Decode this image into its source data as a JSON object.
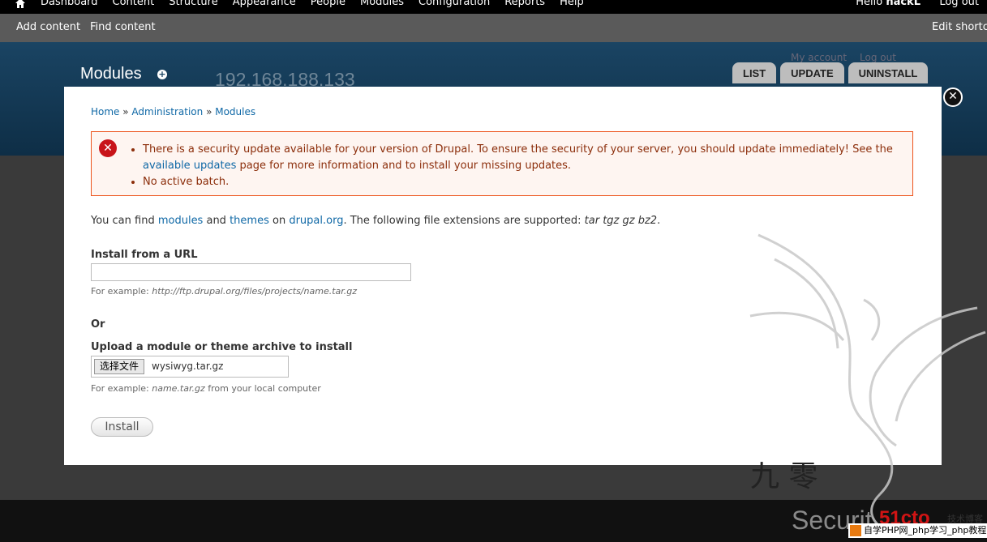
{
  "toolbar": {
    "menu": [
      "Dashboard",
      "Content",
      "Structure",
      "Appearance",
      "People",
      "Modules",
      "Configuration",
      "Reports",
      "Help"
    ],
    "hello": "Hello ",
    "username": "hackL",
    "logout": "Log out"
  },
  "shortcuts": {
    "add_content": "Add content",
    "find_content": "Find content",
    "edit_shortcuts": "Edit shortcuts"
  },
  "header": {
    "title": "Modules",
    "site_ip": "192.168.188.133",
    "my_account": "My account",
    "log_out": "Log out",
    "tabs": [
      "LIST",
      "UPDATE",
      "UNINSTALL"
    ]
  },
  "breadcrumb": [
    "Home",
    "Administration",
    "Modules"
  ],
  "messages": {
    "security_pre": "There is a security update available for your version of Drupal. To ensure the security of your server, you should update immediately! See the ",
    "security_link": "available updates",
    "security_post": " page for more information and to install your missing updates.",
    "batch": "No active batch."
  },
  "intro": {
    "t1": "You can find ",
    "modules_link": "modules",
    "t2": " and ",
    "themes_link": "themes",
    "t3": " on ",
    "drupal_link": "drupal.org",
    "t4": ". The following file extensions are supported: ",
    "extensions": "tar tgz gz bz2",
    "t5": "."
  },
  "form": {
    "url_label": "Install from a URL",
    "url_value": "",
    "url_example_prefix": "For example: ",
    "url_example": "http://ftp.drupal.org/files/projects/name.tar.gz",
    "or": "Or",
    "upload_label": "Upload a module or theme archive to install",
    "file_button": "选择文件",
    "file_name": "wysiwyg.tar.gz",
    "upload_example_prefix": "For example: ",
    "upload_example": "name.tar.gz",
    "upload_example_suffix": " from your local computer",
    "install_button": "Install"
  },
  "watermark": {
    "cn_chars": "九 零",
    "security": "Securit",
    "logo_51": "51cto",
    "cn_small": "技术博客",
    "php_badge": "自学PHP网_php学习_php教程"
  }
}
